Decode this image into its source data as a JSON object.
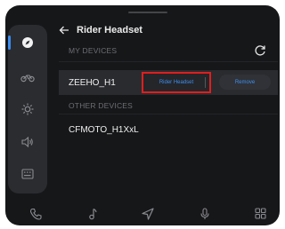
{
  "header": {
    "title": "Rider Headset"
  },
  "sections": {
    "my_devices_label": "MY DEVICES",
    "other_devices_label": "OTHER DEVICES"
  },
  "my_devices": [
    {
      "name": "ZEEHO_H1",
      "action_primary": "Rider Headset",
      "action_secondary": "Remove"
    }
  ],
  "other_devices": [
    {
      "name": "CFMOTO_H1XxL"
    }
  ],
  "rail": {
    "items": [
      {
        "icon": "compass-icon",
        "active": true
      },
      {
        "icon": "motorcycle-icon",
        "active": false
      },
      {
        "icon": "brightness-icon",
        "active": false
      },
      {
        "icon": "volume-icon",
        "active": false
      },
      {
        "icon": "keyboard-icon",
        "active": false
      }
    ]
  },
  "bottom_bar": {
    "items": [
      "phone-icon",
      "music-icon",
      "navigation-icon",
      "microphone-icon",
      "apps-grid-icon"
    ]
  },
  "colors": {
    "accent": "#3b8cf0",
    "highlight_border": "#e01f1f",
    "background": "#161719",
    "rail": "#2b2c30"
  }
}
